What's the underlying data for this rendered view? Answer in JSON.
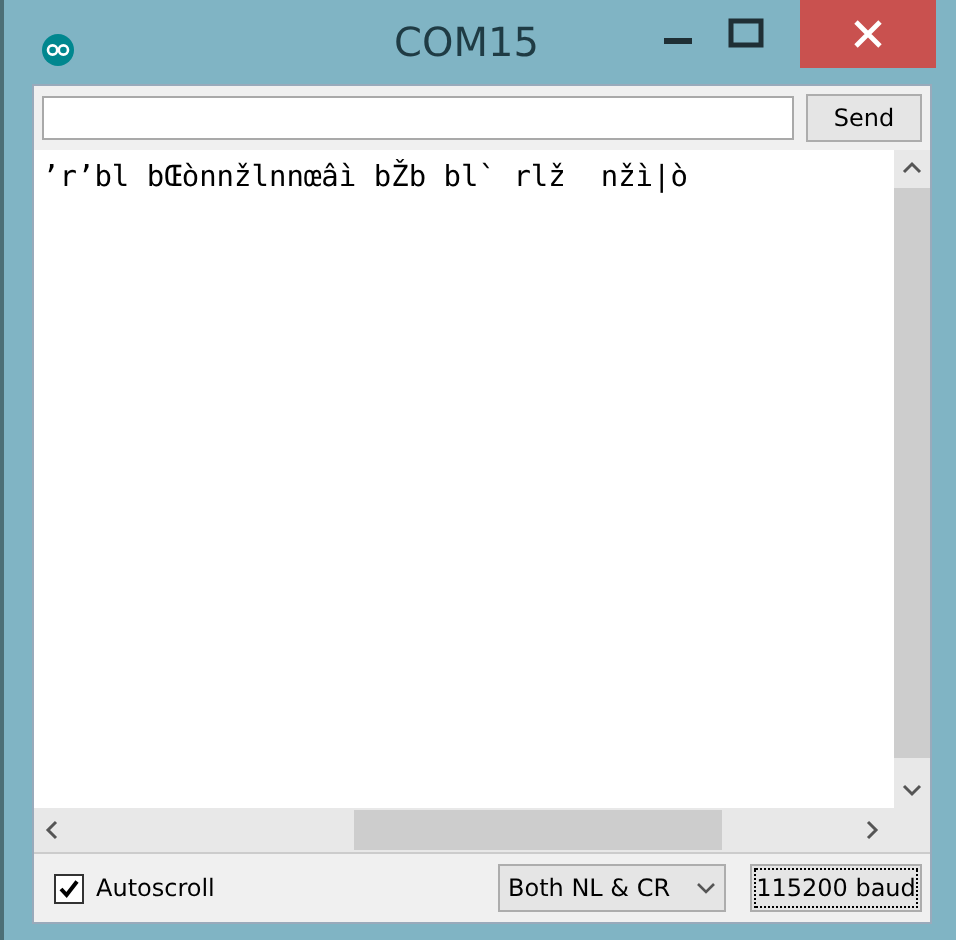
{
  "window": {
    "title": "COM15"
  },
  "send_button": {
    "label": "Send"
  },
  "output": {
    "lines": [
      "ʼrʼbl bŒònnžlnnœâì bŽb bl` rlž  nžì|ò"
    ]
  },
  "autoscroll": {
    "label": "Autoscroll",
    "checked": true
  },
  "line_ending": {
    "value": "Both NL & CR"
  },
  "baud": {
    "value": "115200 baud"
  }
}
